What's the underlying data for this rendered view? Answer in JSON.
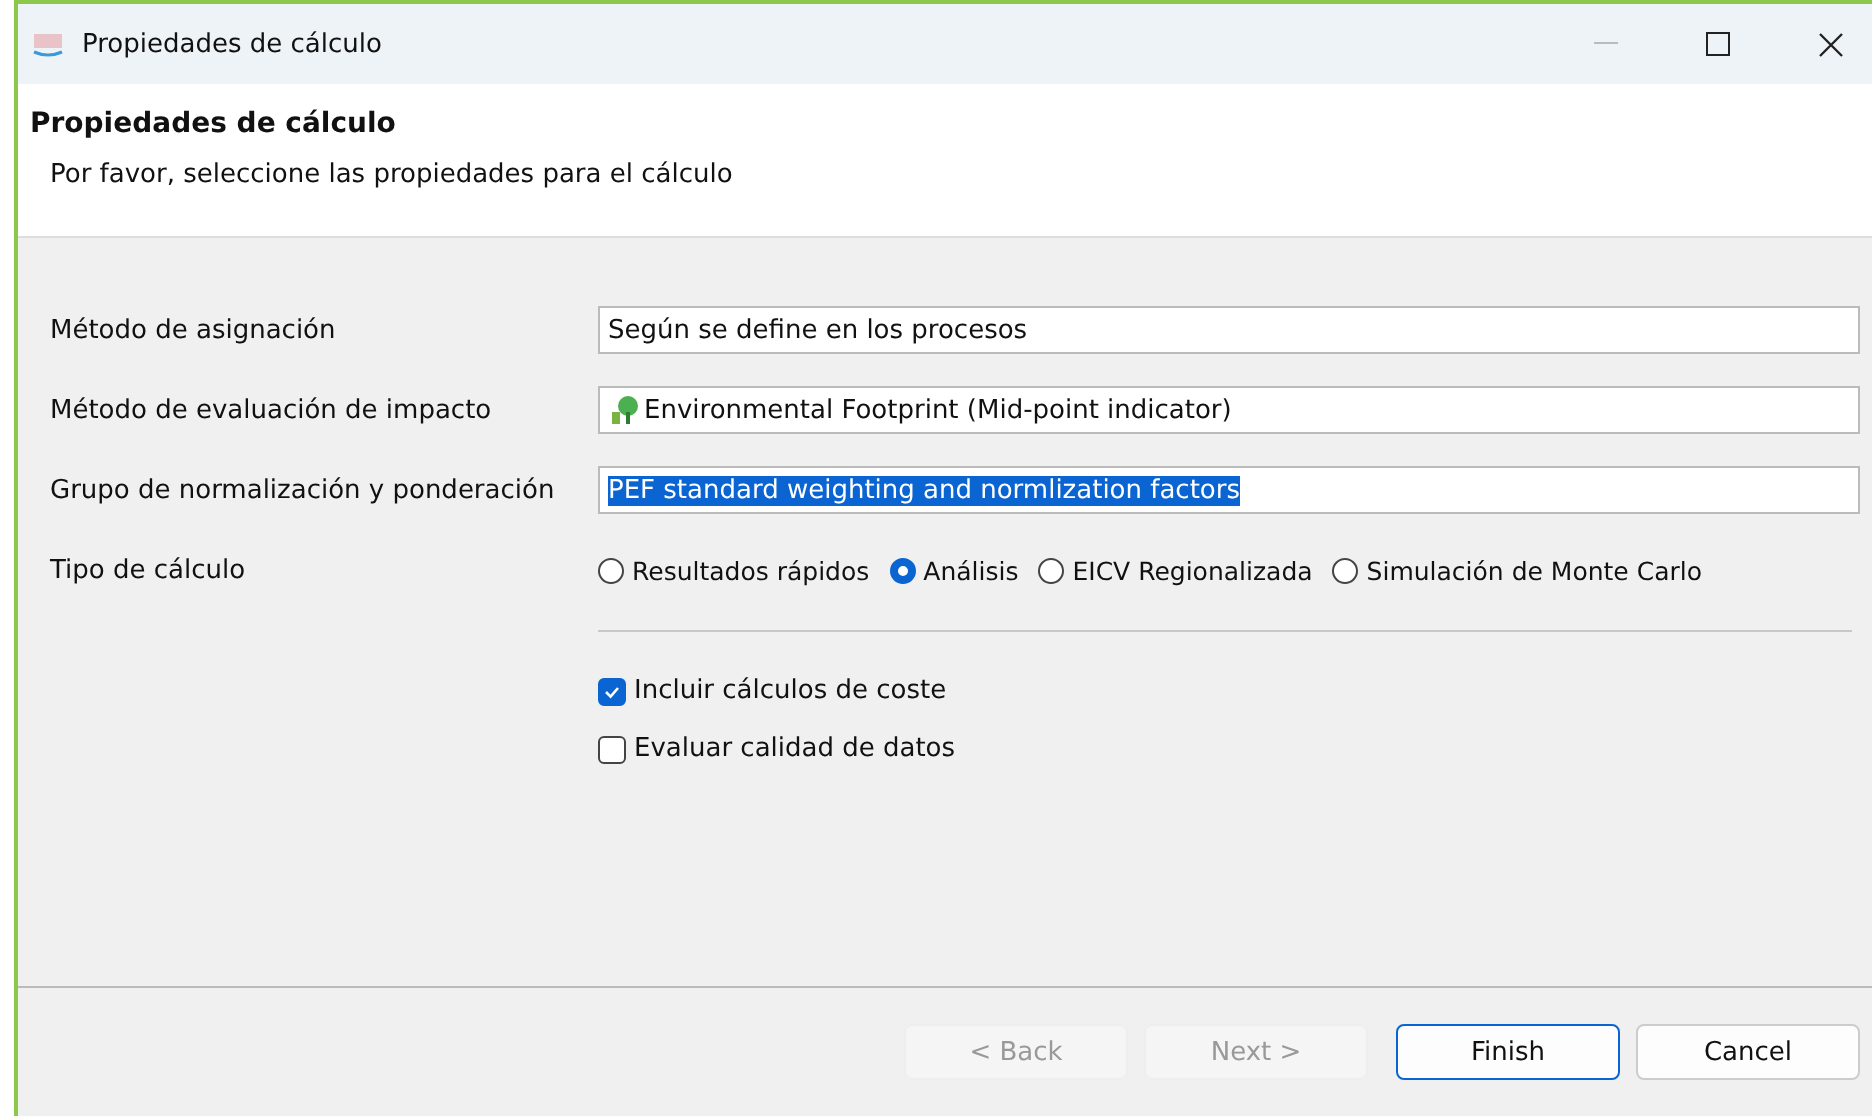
{
  "window": {
    "title": "Propiedades de cálculo"
  },
  "header": {
    "title": "Propiedades de cálculo",
    "description": "Por favor, seleccione las propiedades para el cálculo"
  },
  "fields": [
    {
      "label": "Método de asignación",
      "value": "Según se define en los procesos",
      "icon": false,
      "selected": false
    },
    {
      "label": "Método de evaluación de impacto",
      "value": "Environmental Footprint (Mid-point indicator)",
      "icon": true,
      "selected": false
    },
    {
      "label": "Grupo de normalización y ponderación",
      "value": "PEF standard weighting and normlization factors",
      "icon": false,
      "selected": true
    }
  ],
  "calculation_type": {
    "label": "Tipo de cálculo",
    "options": [
      {
        "label": "Resultados rápidos",
        "selected": false
      },
      {
        "label": "Análisis",
        "selected": true
      },
      {
        "label": "EICV Regionalizada",
        "selected": false
      },
      {
        "label": "Simulación de Monte Carlo",
        "selected": false
      }
    ]
  },
  "checkboxes": [
    {
      "label": "Incluir cálculos de coste",
      "checked": true
    },
    {
      "label": "Evaluar calidad de datos",
      "checked": false
    }
  ],
  "buttons": [
    {
      "label": "< Back",
      "disabled": true,
      "default": false
    },
    {
      "label": "Next >",
      "disabled": true,
      "default": false
    },
    {
      "label": "Finish",
      "disabled": false,
      "default": true
    },
    {
      "label": "Cancel",
      "disabled": false,
      "default": false
    }
  ]
}
